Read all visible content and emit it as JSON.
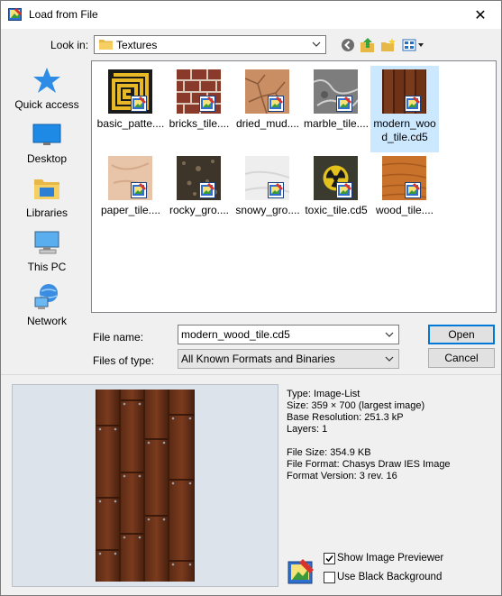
{
  "window": {
    "title": "Load from File",
    "close_glyph": "✕",
    "app_icon": "chasys-draw-icon"
  },
  "toolbar": {
    "look_in_label": "Look in:",
    "look_in_value": "Textures",
    "back_icon": "back-arrow-icon",
    "up_icon": "up-folder-icon",
    "new_folder_icon": "new-folder-icon",
    "view_icon": "view-menu-icon"
  },
  "places": [
    {
      "label": "Quick access",
      "icon": "star-icon"
    },
    {
      "label": "Desktop",
      "icon": "desktop-icon"
    },
    {
      "label": "Libraries",
      "icon": "libraries-icon"
    },
    {
      "label": "This PC",
      "icon": "computer-icon"
    },
    {
      "label": "Network",
      "icon": "network-icon"
    }
  ],
  "files": [
    {
      "name": "basic_patte....",
      "texture": "pattern",
      "selected": false
    },
    {
      "name": "bricks_tile....",
      "texture": "bricks",
      "selected": false
    },
    {
      "name": "dried_mud....",
      "texture": "mud",
      "selected": false
    },
    {
      "name": "marble_tile....",
      "texture": "marble",
      "selected": false
    },
    {
      "name": "modern_wood_tile.cd5",
      "texture": "wood-dark",
      "selected": true
    },
    {
      "name": "paper_tile....",
      "texture": "paper",
      "selected": false
    },
    {
      "name": "rocky_gro....",
      "texture": "rocky",
      "selected": false
    },
    {
      "name": "snowy_gro....",
      "texture": "snow",
      "selected": false
    },
    {
      "name": "toxic_tile.cd5",
      "texture": "toxic",
      "selected": false
    },
    {
      "name": "wood_tile....",
      "texture": "wood-light",
      "selected": false
    }
  ],
  "form": {
    "file_name_label": "File name:",
    "file_name_value": "modern_wood_tile.cd5",
    "file_type_label": "Files of type:",
    "file_type_value": "All Known Formats and Binaries",
    "open_label": "Open",
    "cancel_label": "Cancel"
  },
  "info": {
    "type": "Type: Image-List",
    "size": "Size: 359 × 700  (largest image)",
    "base_resolution": "Base Resolution: 251.3 kP",
    "layers": "Layers: 1",
    "file_size": "File Size: 354.9 KB",
    "file_format": "File Format: Chasys Draw IES Image",
    "format_version": "Format Version: 3 rev. 16"
  },
  "options": {
    "show_previewer_label": "Show Image Previewer",
    "show_previewer_checked": true,
    "black_background_label": "Use Black Background",
    "black_background_checked": false
  }
}
